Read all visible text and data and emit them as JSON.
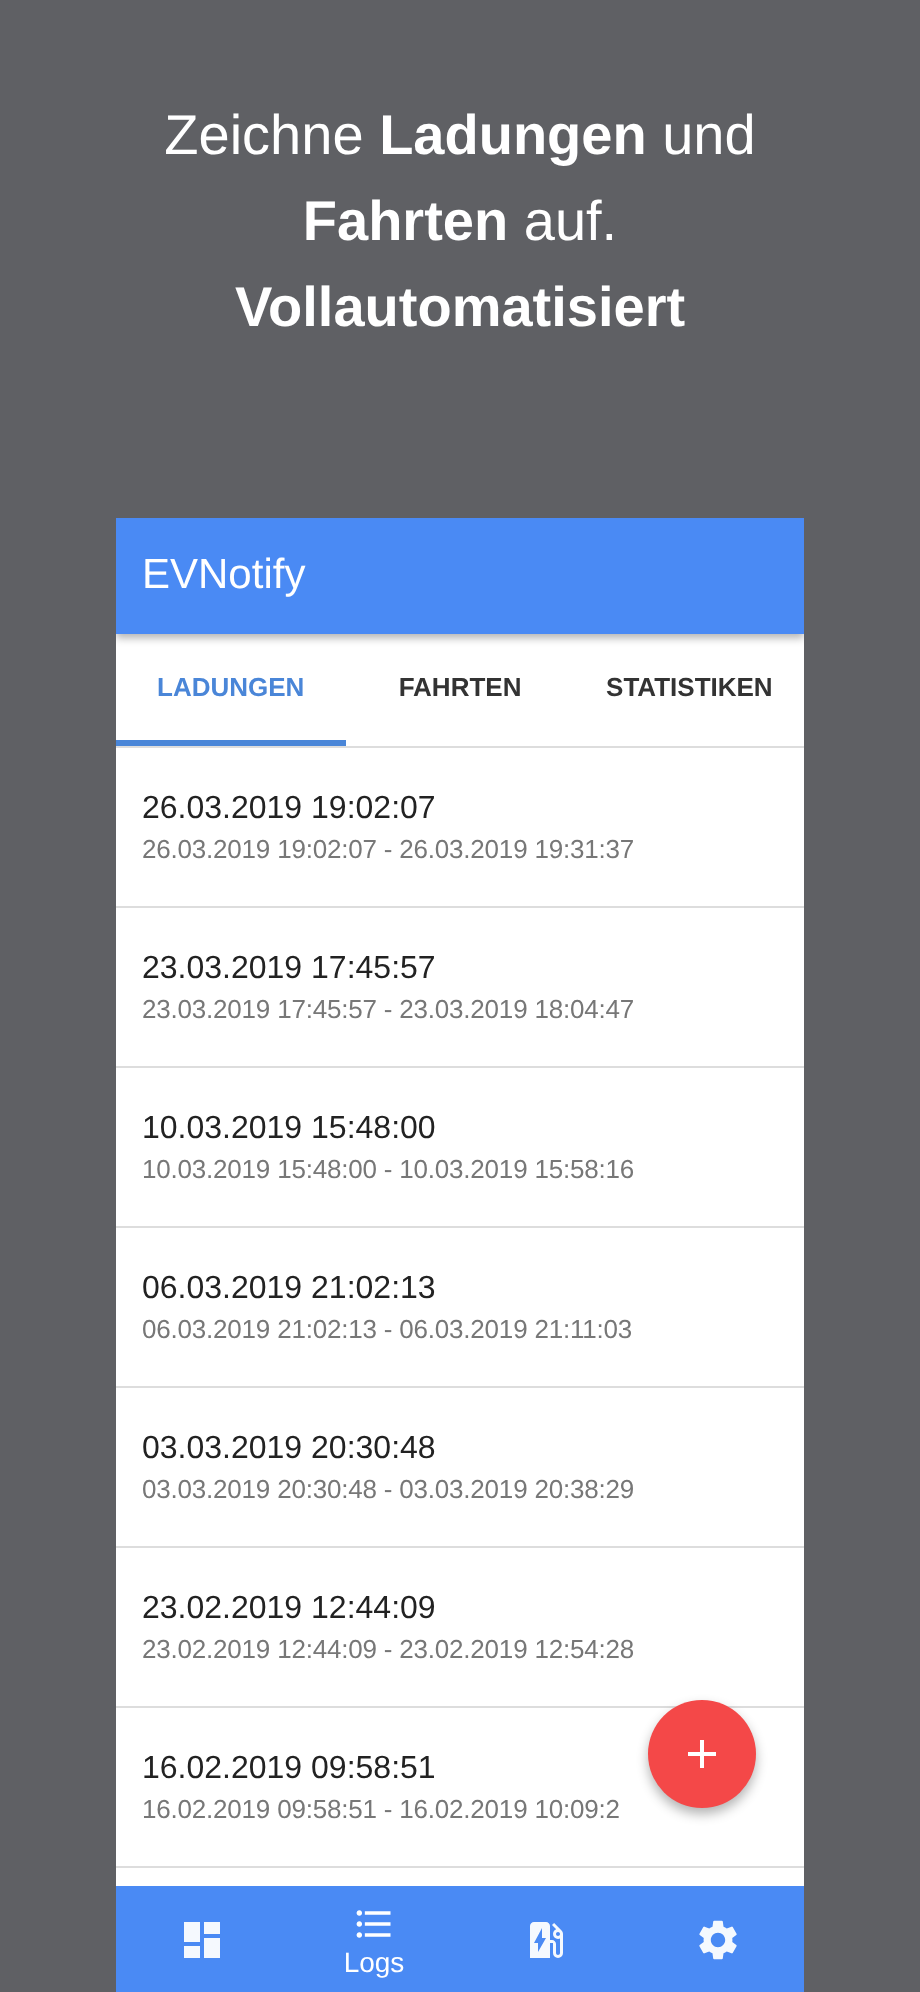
{
  "headline": "Zeichne **Ladungen** und **Fahrten** auf. **Vollautomatisiert**",
  "app_bar": {
    "title": "EVNotify"
  },
  "tabs": [
    {
      "label": "LADUNGEN",
      "selected": true
    },
    {
      "label": "FAHRTEN",
      "selected": false
    },
    {
      "label": "STATISTIKEN",
      "selected": false
    }
  ],
  "logs": [
    {
      "title": "26.03.2019 19:02:07",
      "range": "26.03.2019 19:02:07 - 26.03.2019 19:31:37"
    },
    {
      "title": "23.03.2019 17:45:57",
      "range": "23.03.2019 17:45:57 - 23.03.2019 18:04:47"
    },
    {
      "title": "10.03.2019 15:48:00",
      "range": "10.03.2019 15:48:00 - 10.03.2019 15:58:16"
    },
    {
      "title": "06.03.2019 21:02:13",
      "range": "06.03.2019 21:02:13 - 06.03.2019 21:11:03"
    },
    {
      "title": "03.03.2019 20:30:48",
      "range": "03.03.2019 20:30:48 - 03.03.2019 20:38:29"
    },
    {
      "title": "23.02.2019 12:44:09",
      "range": "23.02.2019 12:44:09 - 23.02.2019 12:54:28"
    },
    {
      "title": "16.02.2019 09:58:51",
      "range": "16.02.2019 09:58:51 - 16.02.2019 10:09:2"
    }
  ],
  "bottom_nav": [
    {
      "kind": "dashboard",
      "selected": false
    },
    {
      "kind": "logs",
      "selected": true,
      "label": "Logs"
    },
    {
      "kind": "charging",
      "selected": false
    },
    {
      "kind": "settings",
      "selected": false
    }
  ]
}
